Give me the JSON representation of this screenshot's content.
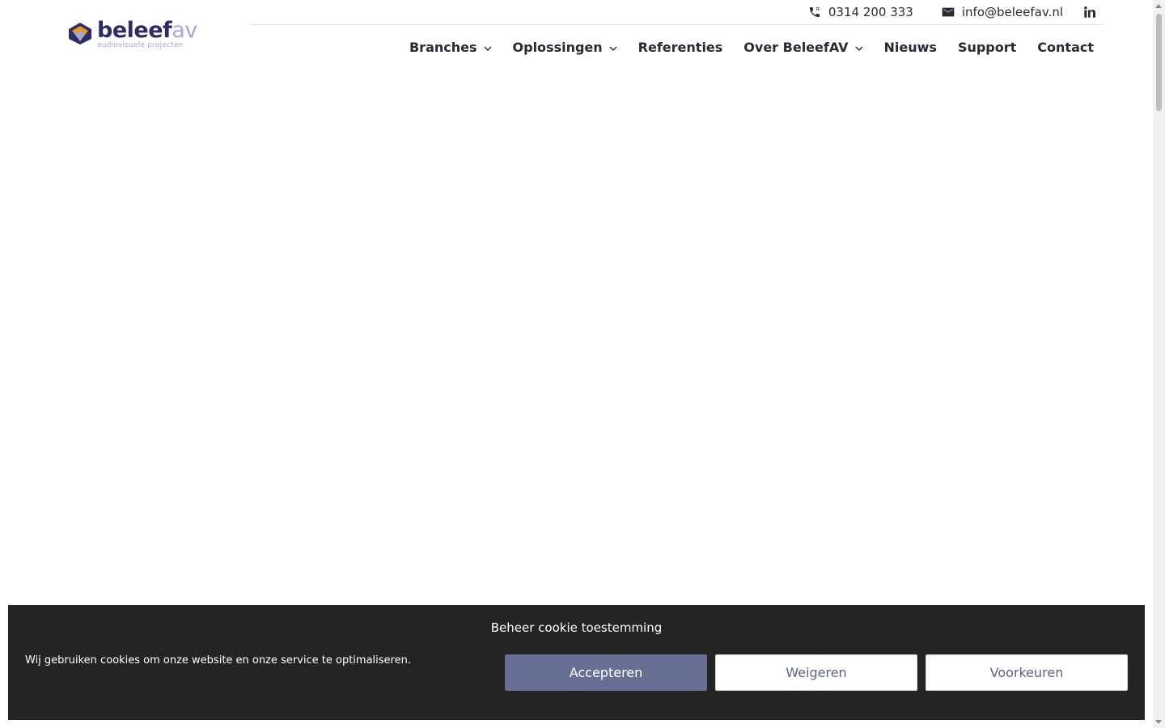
{
  "brand": {
    "name_part1": "beleef",
    "name_part2": "av",
    "tagline": "audiovisuele projecten"
  },
  "topbar": {
    "phone": "0314 200 333",
    "email": "info@beleefav.nl",
    "social_icon": "linkedin-icon"
  },
  "nav": {
    "items": [
      {
        "label": "Branches",
        "dropdown": true
      },
      {
        "label": "Oplossingen",
        "dropdown": true
      },
      {
        "label": "Referenties",
        "dropdown": false
      },
      {
        "label": "Over BeleefAV",
        "dropdown": true
      },
      {
        "label": "Nieuws",
        "dropdown": false
      },
      {
        "label": "Support",
        "dropdown": false
      },
      {
        "label": "Contact",
        "dropdown": false
      }
    ]
  },
  "cookie_banner": {
    "title": "Beheer cookie toestemming",
    "message": "Wij gebruiken cookies om onze website en onze service te optimaliseren.",
    "accept_label": "Accepteren",
    "deny_label": "Weigeren",
    "preferences_label": "Voorkeuren"
  },
  "colors": {
    "brand_dark": "#2c2c66",
    "brand_light": "#a4a8d8",
    "brand_orange": "#e8952f",
    "banner_bg": "#242424",
    "accept_bg": "#676f94"
  }
}
